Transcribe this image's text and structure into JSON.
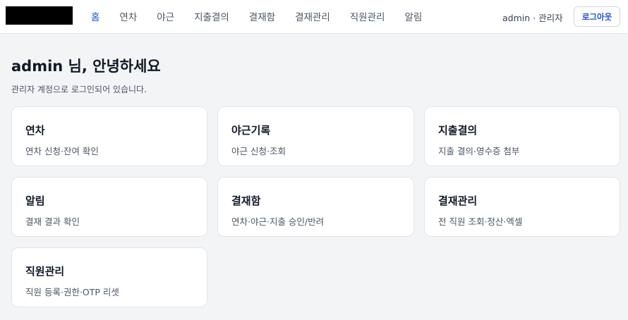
{
  "header": {
    "nav": [
      {
        "label": "홈",
        "active": true
      },
      {
        "label": "연차",
        "active": false
      },
      {
        "label": "야근",
        "active": false
      },
      {
        "label": "지출결의",
        "active": false
      },
      {
        "label": "결재함",
        "active": false
      },
      {
        "label": "결재관리",
        "active": false
      },
      {
        "label": "직원관리",
        "active": false
      },
      {
        "label": "알림",
        "active": false
      }
    ],
    "user_info": "admin · 관리자",
    "logout_label": "로그아웃"
  },
  "main": {
    "title": "admin 님, 안녕하세요",
    "subtitle": "관리자 계정으로 로그인되어 있습니다.",
    "cards": [
      {
        "title": "연차",
        "desc": "연차 신청·잔여 확인"
      },
      {
        "title": "야근기록",
        "desc": "야근 신청·조회"
      },
      {
        "title": "지출결의",
        "desc": "지출 결의·영수증 첨부"
      },
      {
        "title": "알림",
        "desc": "결재 결과 확인"
      },
      {
        "title": "결재함",
        "desc": "연차·야근·지출 승인/반려"
      },
      {
        "title": "결재관리",
        "desc": "전 직원 조회·정산·엑셀"
      },
      {
        "title": "직원관리",
        "desc": "직원 등록·권한·OTP 리셋"
      }
    ]
  },
  "colors": {
    "accent": "#1d4ed8",
    "background": "#f3f4f6",
    "card": "#ffffff"
  }
}
